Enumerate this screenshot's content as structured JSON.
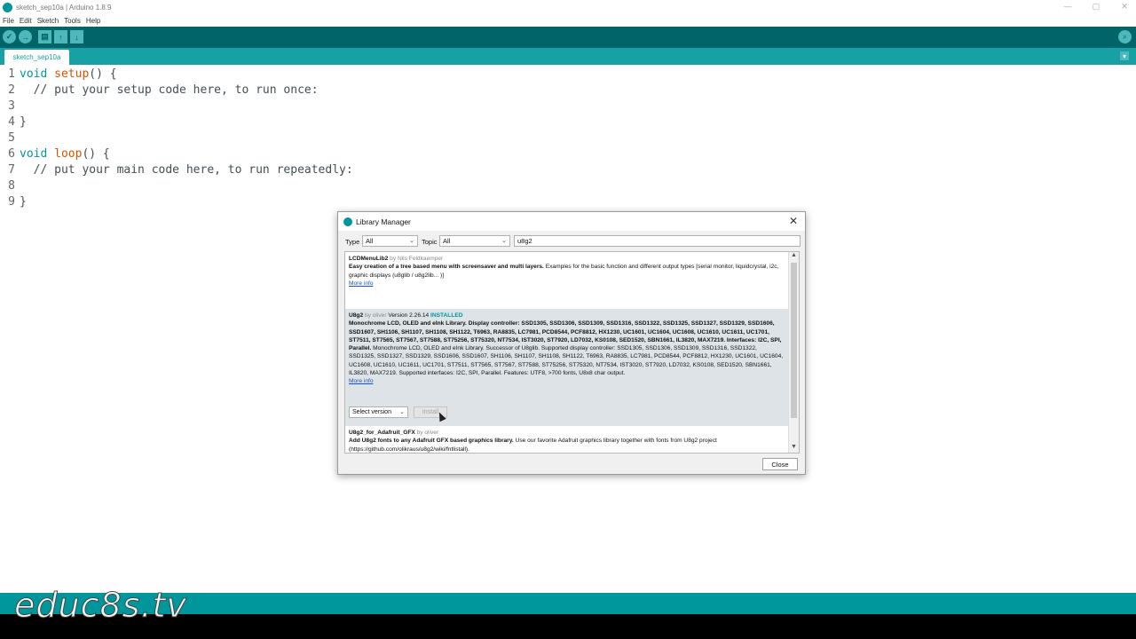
{
  "window": {
    "title": "sketch_sep10a | Arduino 1.8.9",
    "controls": [
      "—",
      "▢",
      "✕"
    ]
  },
  "menu": [
    "File",
    "Edit",
    "Sketch",
    "Tools",
    "Help"
  ],
  "toolbar": {
    "verify": "✓",
    "upload": "→",
    "new": "▤",
    "open": "↑",
    "save": "↓",
    "serial_monitor": "⌕"
  },
  "tabs": [
    {
      "label": "sketch_sep10a"
    }
  ],
  "tab_menu": "▾",
  "code": {
    "lines": [
      {
        "num": "1",
        "kw": "void",
        "fn": "setup",
        "rest": "() {"
      },
      {
        "num": "2",
        "text": "  // put your setup code here, to run once:"
      },
      {
        "num": "3",
        "text": ""
      },
      {
        "num": "4",
        "text": "}"
      },
      {
        "num": "5",
        "text": ""
      },
      {
        "num": "6",
        "kw": "void",
        "fn": "loop",
        "rest": "() {"
      },
      {
        "num": "7",
        "text": "  // put your main code here, to run repeatedly:"
      },
      {
        "num": "8",
        "text": ""
      },
      {
        "num": "9",
        "text": "}"
      }
    ]
  },
  "watermark": "educ8s.tv",
  "dialog": {
    "title": "Library Manager",
    "close_icon": "✕",
    "type_label": "Type",
    "type_value": "All",
    "topic_label": "Topic",
    "topic_value": "All",
    "search_value": "u8g2",
    "entries": [
      {
        "name": "LCDMenuLib2",
        "by": " by Nils Feldkaemper",
        "bold": "Easy creation of a tree based menu with screensaver and multi layers.",
        "desc": " Examples for the basic function and different output types [serial monitor, liquidcrystal, i2c, graphic displays (u8glib / u8g2lib... )]",
        "more": "More info"
      },
      {
        "name": "U8g2",
        "by": " by oliver",
        "version": " Version 2.26.14 ",
        "installed": "INSTALLED",
        "bold": "Monochrome LCD, OLED and eInk Library. Display controller: SSD1305, SSD1306, SSD1309, SSD1316, SSD1322, SSD1325, SSD1327, SSD1329, SSD1606, SSD1607, SH1106, SH1107, SH1108, SH1122, T6963, RA8835, LC7981, PCD8544, PCF8812, HX1230, UC1601, UC1604, UC1608, UC1610, UC1611, UC1701, ST7511, ST7565, ST7567, ST7588, ST75256, ST75320, NT7534, IST3020, ST7920, LD7032, KS0108, SED1520, SBN1661, IL3820, MAX7219. Interfaces: I2C, SPI, Parallel.",
        "desc": " Monochrome LCD, OLED and eInk Library. Successor of U8glib. Supported display controller: SSD1305, SSD1306, SSD1309, SSD1316, SSD1322, SSD1325, SSD1327, SSD1329, SSD1606, SSD1607, SH1106, SH1107, SH1108, SH1122, T6963, RA8835, LC7981, PCD8544, PCF8812, HX1230, UC1601, UC1604, UC1608, UC1610, UC1611, UC1701, ST7511, ST7565, ST7567, ST7588, ST75256, ST75320, NT7534, IST3020, ST7920, LD7032, KS0108, SED1520, SBN1661, IL3820, MAX7219. Supported interfaces: I2C, SPI, Parallel. Features: UTF8, >700 fonts, U8x8 char output.",
        "more": "More info",
        "select_version": "Select version",
        "install": "Install"
      },
      {
        "name": "U8g2_for_Adafruit_GFX",
        "by": " by oliver",
        "bold": "Add U8g2 fonts to any Adafruit GFX based graphics library.",
        "desc": " Use our favorite Adafruit graphics library together with fonts from U8g2 project (https://github.com/olikraus/u8g2/wiki/fntlistall)."
      }
    ],
    "close_button": "Close"
  }
}
